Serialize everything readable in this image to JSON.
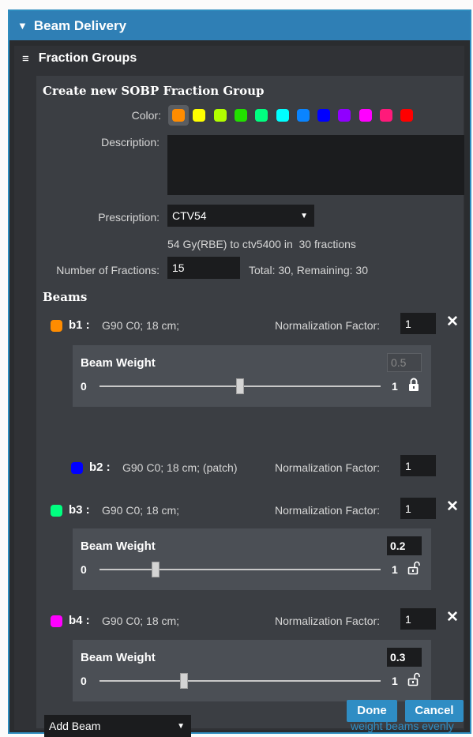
{
  "header": {
    "title": "Beam Delivery"
  },
  "fraction_groups": {
    "title": "Fraction Groups"
  },
  "create": {
    "title": "Create new SOBP Fraction Group",
    "color_label": "Color:",
    "colors": [
      "#ff8c00",
      "#ffff00",
      "#b2ff00",
      "#22e000",
      "#00ff80",
      "#00ffff",
      "#0a84ff",
      "#0000ff",
      "#9000ff",
      "#ff00ff",
      "#ff1a7a",
      "#ff0000"
    ],
    "selected_color_index": 0,
    "description_label": "Description:",
    "description_value": "",
    "prescription_label": "Prescription:",
    "prescription_value": "CTV54",
    "prescription_info": "54 Gy(RBE) to ctv5400 in  30 fractions",
    "num_fractions_label": "Number of Fractions:",
    "num_fractions_value": "15",
    "totals": "Total: 30, Remaining: 30"
  },
  "beams_title": "Beams",
  "beams": [
    {
      "name": "b1 :",
      "desc": "G90 C0; 18 cm;",
      "color": "#ff8c00",
      "norm_label": "Normalization Factor:",
      "norm_value": "1",
      "weight_label": "Beam Weight",
      "weight_value": "0.5",
      "weight": 0.5,
      "min": "0",
      "max": "1",
      "locked": true
    },
    {
      "name": "b2 :",
      "desc": "G90 C0; 18 cm; (patch)",
      "color": "#0000ff",
      "norm_label": "Normalization Factor:",
      "norm_value": "1"
    },
    {
      "name": "b3 :",
      "desc": "G90 C0; 18 cm;",
      "color": "#00ff80",
      "norm_label": "Normalization Factor:",
      "norm_value": "1",
      "weight_label": "Beam Weight",
      "weight_value": "0.2",
      "weight": 0.2,
      "min": "0",
      "max": "1",
      "locked": false
    },
    {
      "name": "b4 :",
      "desc": "G90 C0; 18 cm;",
      "color": "#ff00ff",
      "norm_label": "Normalization Factor:",
      "norm_value": "1",
      "weight_label": "Beam Weight",
      "weight_value": "0.3",
      "weight": 0.3,
      "min": "0",
      "max": "1",
      "locked": false
    }
  ],
  "add_beam": "Add Beam",
  "weight_evenly": "weight beams evenly",
  "done": "Done",
  "cancel": "Cancel"
}
